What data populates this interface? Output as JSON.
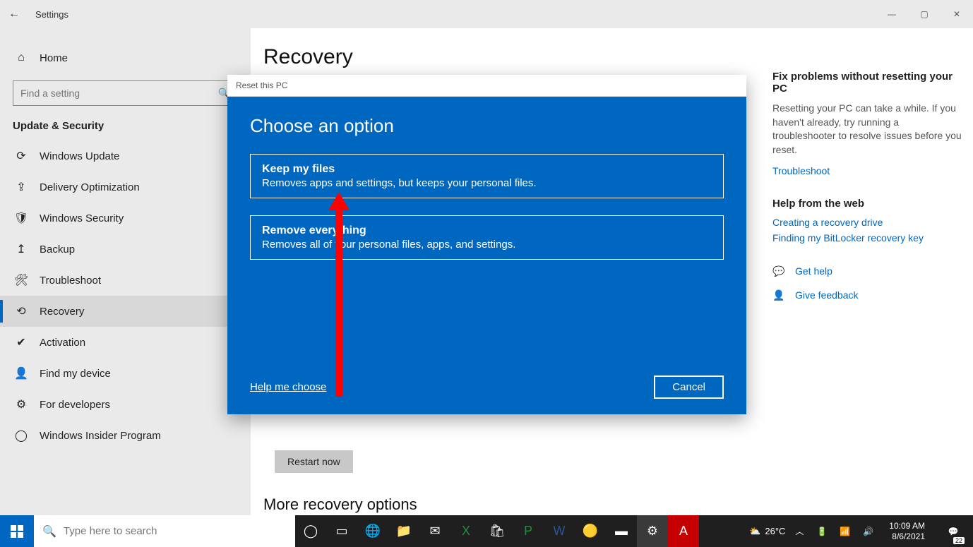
{
  "app": {
    "title": "Settings"
  },
  "window_controls": {
    "min": "—",
    "max": "▢",
    "close": "✕"
  },
  "sidebar": {
    "home": "Home",
    "search_placeholder": "Find a setting",
    "category": "Update & Security",
    "items": [
      {
        "icon": "sync",
        "label": "Windows Update"
      },
      {
        "icon": "delivery",
        "label": "Delivery Optimization"
      },
      {
        "icon": "shield",
        "label": "Windows Security"
      },
      {
        "icon": "backup",
        "label": "Backup"
      },
      {
        "icon": "wrench",
        "label": "Troubleshoot"
      },
      {
        "icon": "recovery",
        "label": "Recovery"
      },
      {
        "icon": "check",
        "label": "Activation"
      },
      {
        "icon": "find",
        "label": "Find my device"
      },
      {
        "icon": "dev",
        "label": "For developers"
      },
      {
        "icon": "insider",
        "label": "Windows Insider Program"
      }
    ],
    "selected_index": 5
  },
  "main": {
    "page_title": "Recovery",
    "restart_button": "Restart now",
    "more": "More recovery options"
  },
  "right": {
    "fix_head": "Fix problems without resetting your PC",
    "fix_text": "Resetting your PC can take a while. If you haven't already, try running a troubleshooter to resolve issues before you reset.",
    "troubleshoot": "Troubleshoot",
    "help_web_head": "Help from the web",
    "help_links": [
      "Creating a recovery drive",
      "Finding my BitLocker recovery key"
    ],
    "get_help": "Get help",
    "feedback": "Give feedback"
  },
  "dialog": {
    "title": "Reset this PC",
    "heading": "Choose an option",
    "options": [
      {
        "title": "Keep my files",
        "desc": "Removes apps and settings, but keeps your personal files."
      },
      {
        "title": "Remove everything",
        "desc": "Removes all of your personal files, apps, and settings."
      }
    ],
    "help": "Help me choose",
    "cancel": "Cancel"
  },
  "taskbar": {
    "search_placeholder": "Type here to search",
    "temp": "26°C",
    "time": "10:09 AM",
    "date": "8/6/2021",
    "notif_count": "22"
  }
}
